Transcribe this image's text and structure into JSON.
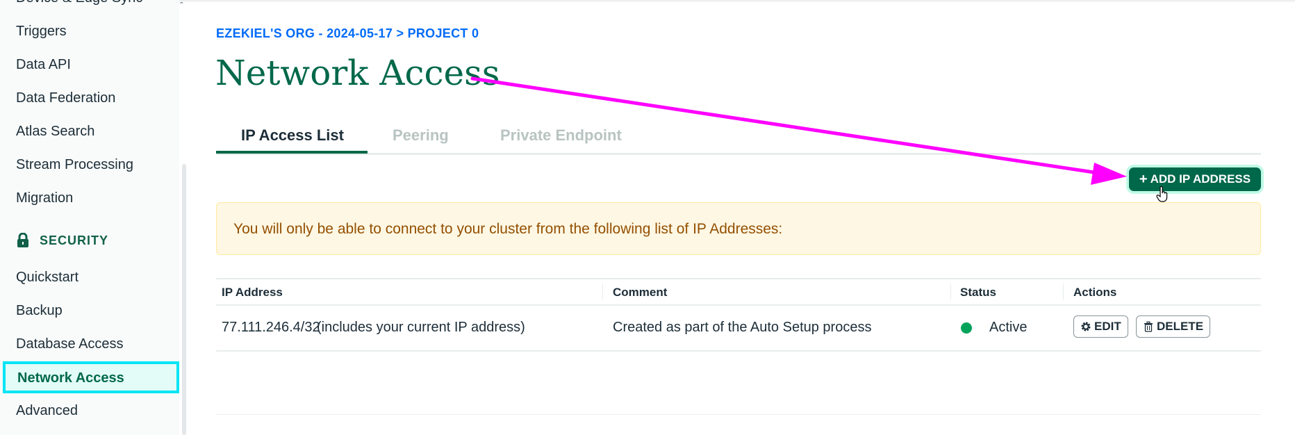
{
  "sidebar": {
    "cut_item": "Device & Edge Sync",
    "items": [
      "Triggers",
      "Data API",
      "Data Federation",
      "Atlas Search",
      "Stream Processing",
      "Migration"
    ],
    "security_header": "SECURITY",
    "security_items": [
      "Quickstart",
      "Backup",
      "Database Access",
      "Network Access",
      "Advanced"
    ],
    "active_item": "Network Access"
  },
  "breadcrumb": "EZEKIEL'S ORG - 2024-05-17 > PROJECT 0",
  "page_title": "Network Access",
  "tabs": [
    {
      "label": "IP Access List",
      "active": true
    },
    {
      "label": "Peering",
      "active": false
    },
    {
      "label": "Private Endpoint",
      "active": false
    }
  ],
  "add_button": {
    "label": "ADD IP ADDRESS",
    "icon": "plus-icon"
  },
  "banner_text": "You will only be able to connect to your cluster from the following list of IP Addresses:",
  "table": {
    "columns": [
      "IP Address",
      "Comment",
      "Status",
      "Actions"
    ],
    "rows": [
      {
        "ip": "77.111.246.4/32",
        "ip_note": "(includes your current IP address)",
        "comment": "Created as part of the Auto Setup process",
        "status": "Active",
        "edit_label": "EDIT",
        "delete_label": "DELETE"
      }
    ]
  },
  "colors": {
    "brand_green": "#00684a",
    "status_active": "#00a35c",
    "annotation_arrow": "#ff00ff",
    "highlight_box": "#00e5f5",
    "breadcrumb_blue": "#016bf8"
  }
}
